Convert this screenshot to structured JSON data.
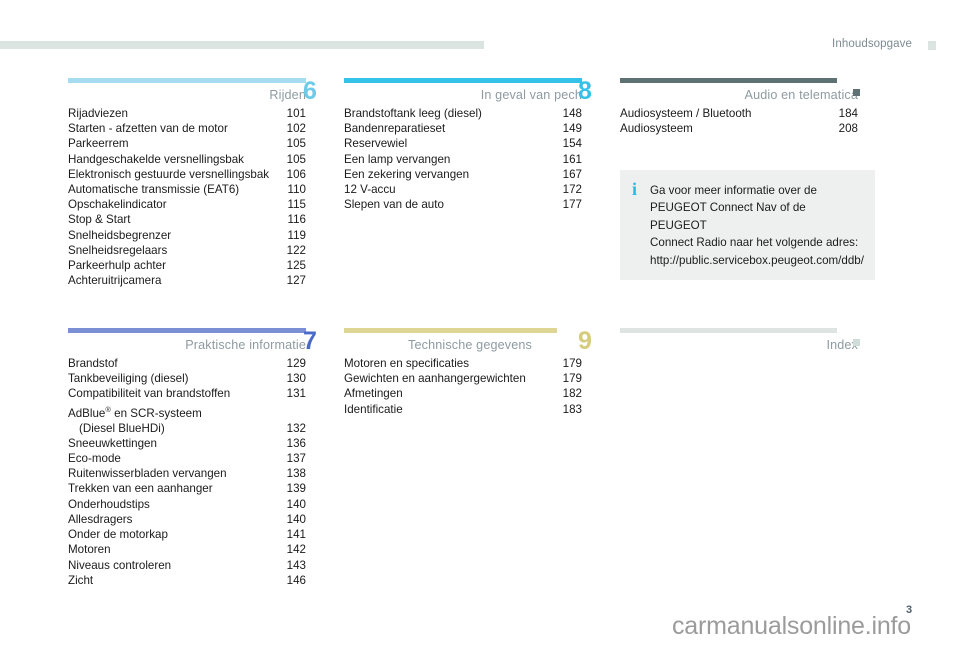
{
  "header": {
    "title": "Inhoudsopgave",
    "bar_color": "#dce4e2",
    "marker_color": "#dce4e2"
  },
  "footer": {
    "page_number": "3",
    "watermark": "carmanualsonline.info"
  },
  "blocks": [
    {
      "id": "rijden",
      "number": "6",
      "title": "Rijden",
      "bar_color": "#a6dcf0",
      "number_color": "#6ecbe8",
      "entries": [
        {
          "label": "Rijadviezen",
          "page": "101"
        },
        {
          "label": "Starten - afzetten van de motor",
          "page": "102"
        },
        {
          "label": "Parkeerrem",
          "page": "105"
        },
        {
          "label": "Handgeschakelde versnellingsbak",
          "page": "105"
        },
        {
          "label": "Elektronisch gestuurde versnellingsbak",
          "page": "106"
        },
        {
          "label": "Automatische transmissie (EAT6)",
          "page": "110"
        },
        {
          "label": "Opschakelindicator",
          "page": "115"
        },
        {
          "label": "Stop & Start",
          "page": "116"
        },
        {
          "label": "Snelheidsbegrenzer",
          "page": "119"
        },
        {
          "label": "Snelheidsregelaars",
          "page": "122"
        },
        {
          "label": "Parkeerhulp achter",
          "page": "125"
        },
        {
          "label": "Achteruitrijcamera",
          "page": "127"
        }
      ]
    },
    {
      "id": "in-geval-van-pech",
      "number": "8",
      "title": "In geval van pech",
      "bar_color": "#35c2e8",
      "number_color": "#35c2e8",
      "entries": [
        {
          "label": "Brandstoftank leeg (diesel)",
          "page": "148"
        },
        {
          "label": "Bandenreparatieset",
          "page": "149"
        },
        {
          "label": "Reservewiel",
          "page": "154"
        },
        {
          "label": "Een lamp vervangen",
          "page": "161"
        },
        {
          "label": "Een zekering vervangen",
          "page": "167"
        },
        {
          "label": "12 V-accu",
          "page": "172"
        },
        {
          "label": "Slepen van de auto",
          "page": "177"
        }
      ]
    },
    {
      "id": "audio-en-telematica",
      "number": "",
      "title": "Audio en telematica",
      "bar_color": "#5f7273",
      "number_color": "#5f7273",
      "marker_color": "#5f7273",
      "entries": [
        {
          "label": "Audiosysteem / Bluetooth",
          "page": "184"
        },
        {
          "label": "Audiosysteem",
          "page": "208"
        }
      ]
    },
    {
      "id": "praktische-informatie",
      "number": "7",
      "title": "Praktische informatie",
      "bar_color": "#7b8fd4",
      "number_color": "#4a69c9",
      "entries": [
        {
          "label": "Brandstof",
          "page": "129"
        },
        {
          "label": "Tankbeveiliging (diesel)",
          "page": "130"
        },
        {
          "label": "Compatibiliteit van brandstoffen",
          "page": "131"
        },
        {
          "label": "AdBlue® en SCR-systeem",
          "page": "",
          "no_page": true
        },
        {
          "label": "(Diesel BlueHDi)",
          "page": "132",
          "indent": true
        },
        {
          "label": "Sneeuwkettingen",
          "page": "136"
        },
        {
          "label": "Eco-mode",
          "page": "137"
        },
        {
          "label": "Ruitenwisserbladen vervangen",
          "page": "138"
        },
        {
          "label": "Trekken van een aanhanger",
          "page": "139"
        },
        {
          "label": "Onderhoudstips",
          "page": "140"
        },
        {
          "label": "Allesdragers",
          "page": "140"
        },
        {
          "label": "Onder de motorkap",
          "page": "141"
        },
        {
          "label": "Motoren",
          "page": "142"
        },
        {
          "label": "Niveaus controleren",
          "page": "143"
        },
        {
          "label": "Zicht",
          "page": "146"
        }
      ]
    },
    {
      "id": "technische-gegevens",
      "number": "9",
      "title": "Technische gegevens",
      "bar_color": "#ddd694",
      "number_color": "#d6cc7e",
      "entries": [
        {
          "label": "Motoren en specificaties",
          "page": "179"
        },
        {
          "label": "Gewichten en aanhangergewichten",
          "page": "179"
        },
        {
          "label": "Afmetingen",
          "page": "182"
        },
        {
          "label": "Identificatie",
          "page": "183"
        }
      ]
    },
    {
      "id": "index",
      "number": "",
      "title": "Index",
      "bar_color": "#dde4e1",
      "number_color": "#dde4e1",
      "marker_color": "#cfdcd7",
      "entries": []
    }
  ],
  "infobox": {
    "icon": "info-i",
    "icon_color": "#2eb8e6",
    "background": "#eef0ef",
    "lines": [
      "Ga voor meer informatie over de",
      "PEUGEOT Connect Nav of de PEUGEOT",
      "Connect Radio naar het volgende adres:",
      "http://public.servicebox.peugeot.com/ddb/"
    ]
  }
}
